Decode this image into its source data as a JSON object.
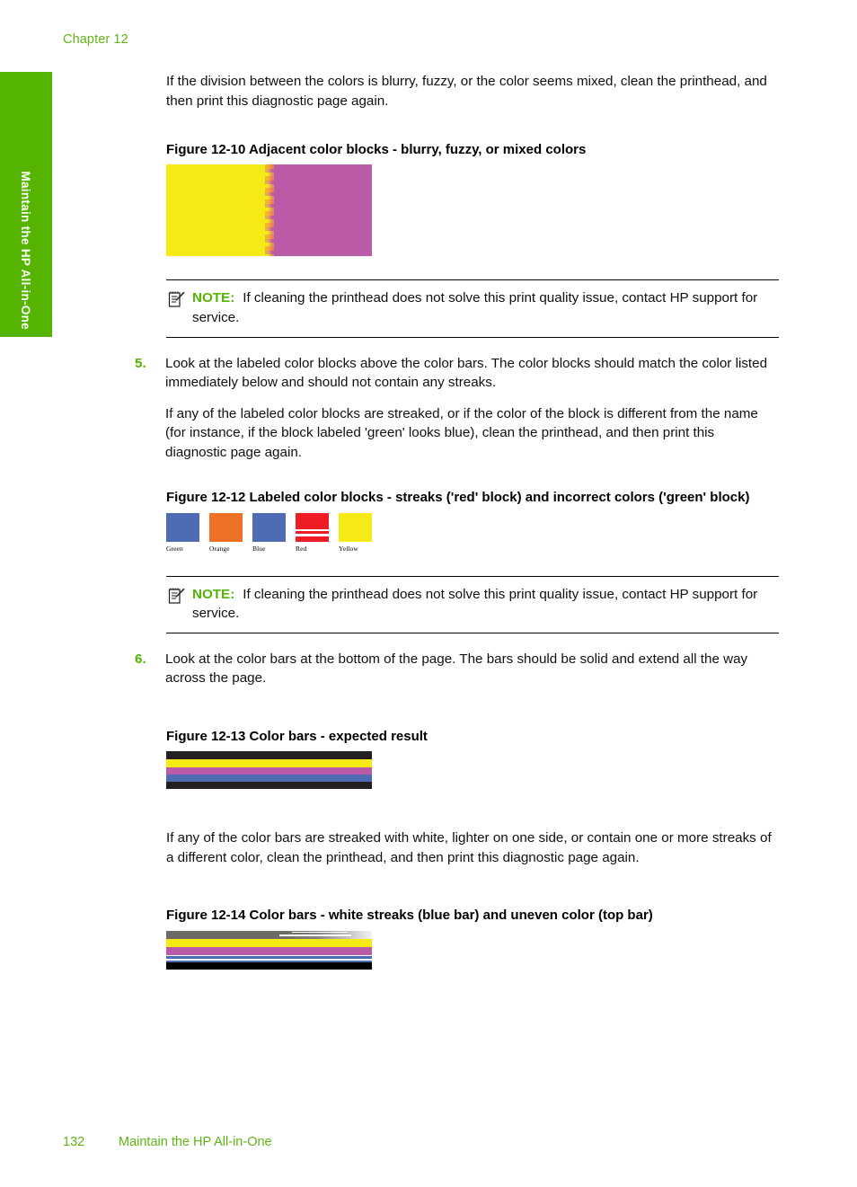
{
  "page": {
    "chapter_label": "Chapter 12",
    "side_tab_label": "Maintain the HP All-in-One",
    "side_tab_color": "#55b400",
    "accent_green": "#5fb316"
  },
  "intro_paragraph": "If the division between the colors is blurry, fuzzy, or the color seems mixed, clean the printhead, and then print this diagnostic page again.",
  "figure_12_10": {
    "caption": "Figure 12-10 Adjacent color blocks - blurry, fuzzy, or mixed colors",
    "left_block_color": "#f5e916",
    "right_block_color": "#bb5aa6",
    "seam_color": "#f7963c"
  },
  "note_1": {
    "icon": "note-pencil-icon",
    "keyword": "NOTE:",
    "text": "If cleaning the printhead does not solve this print quality issue, contact HP support for service.",
    "keyword_color": "#55b400"
  },
  "step_5": {
    "number": "5.",
    "paragraph_1": "Look at the labeled color blocks above the color bars. The color blocks should match the color listed immediately below and should not contain any streaks.",
    "paragraph_2": "If any of the labeled color blocks are streaked, or if the color of the block is different from the name (for instance, if the block labeled 'green' looks blue), clean the printhead, and then print this diagnostic page again."
  },
  "figure_12_12": {
    "caption": "Figure 12-12 Labeled color blocks - streaks ('red' block) and incorrect colors ('green' block)",
    "blocks": [
      {
        "label": "Green",
        "color": "#4e6cb4",
        "streaked": false
      },
      {
        "label": "Orange",
        "color": "#ef7125",
        "streaked": false
      },
      {
        "label": "Blue",
        "color": "#4e6cb4",
        "streaked": false
      },
      {
        "label": "Red",
        "color": "#ee1c25",
        "streaked": true
      },
      {
        "label": "Yellow",
        "color": "#f5e916",
        "streaked": false
      }
    ]
  },
  "note_2": {
    "icon": "note-pencil-icon",
    "keyword": "NOTE:",
    "text": "If cleaning the printhead does not solve this print quality issue, contact HP support for service.",
    "keyword_color": "#55b400"
  },
  "step_6": {
    "number": "6.",
    "paragraph_1": "Look at the color bars at the bottom of the page. The bars should be solid and extend all the way across the page."
  },
  "figure_12_13": {
    "caption": "Figure 12-13 Color bars - expected result",
    "bars": [
      {
        "name": "black-bar-top",
        "color": "#231f20",
        "height": 9
      },
      {
        "name": "yellow-bar",
        "color": "#f5e916",
        "height": 9
      },
      {
        "name": "magenta-bar",
        "color": "#bb5aa6",
        "height": 8
      },
      {
        "name": "blue-bar",
        "color": "#4e6cb4",
        "height": 8
      },
      {
        "name": "black-bar-bottom",
        "color": "#231f20",
        "height": 8
      }
    ]
  },
  "closing_paragraph": "If any of the color bars are streaked with white, lighter on one side, or contain one or more streaks of a different color, clean the printhead, and then print this diagnostic page again.",
  "figure_12_14": {
    "caption": "Figure 12-14 Color bars - white streaks (blue bar) and uneven color (top bar)",
    "bars": [
      {
        "name": "gray-uneven-top-bar",
        "color": "#6e6a66",
        "height": 9,
        "defect": "uneven-fading"
      },
      {
        "name": "yellow-bar",
        "color": "#f5e916",
        "height": 9,
        "defect": "none"
      },
      {
        "name": "magenta-bar",
        "color": "#bb5aa6",
        "height": 9,
        "defect": "none"
      },
      {
        "name": "blue-bar",
        "color": "#4e6cb4",
        "height": 8,
        "defect": "white-streaks"
      },
      {
        "name": "black-bar-bottom",
        "color": "#000000",
        "height": 8,
        "defect": "none"
      }
    ]
  },
  "footer": {
    "page_number": "132",
    "title": "Maintain the HP All-in-One"
  }
}
